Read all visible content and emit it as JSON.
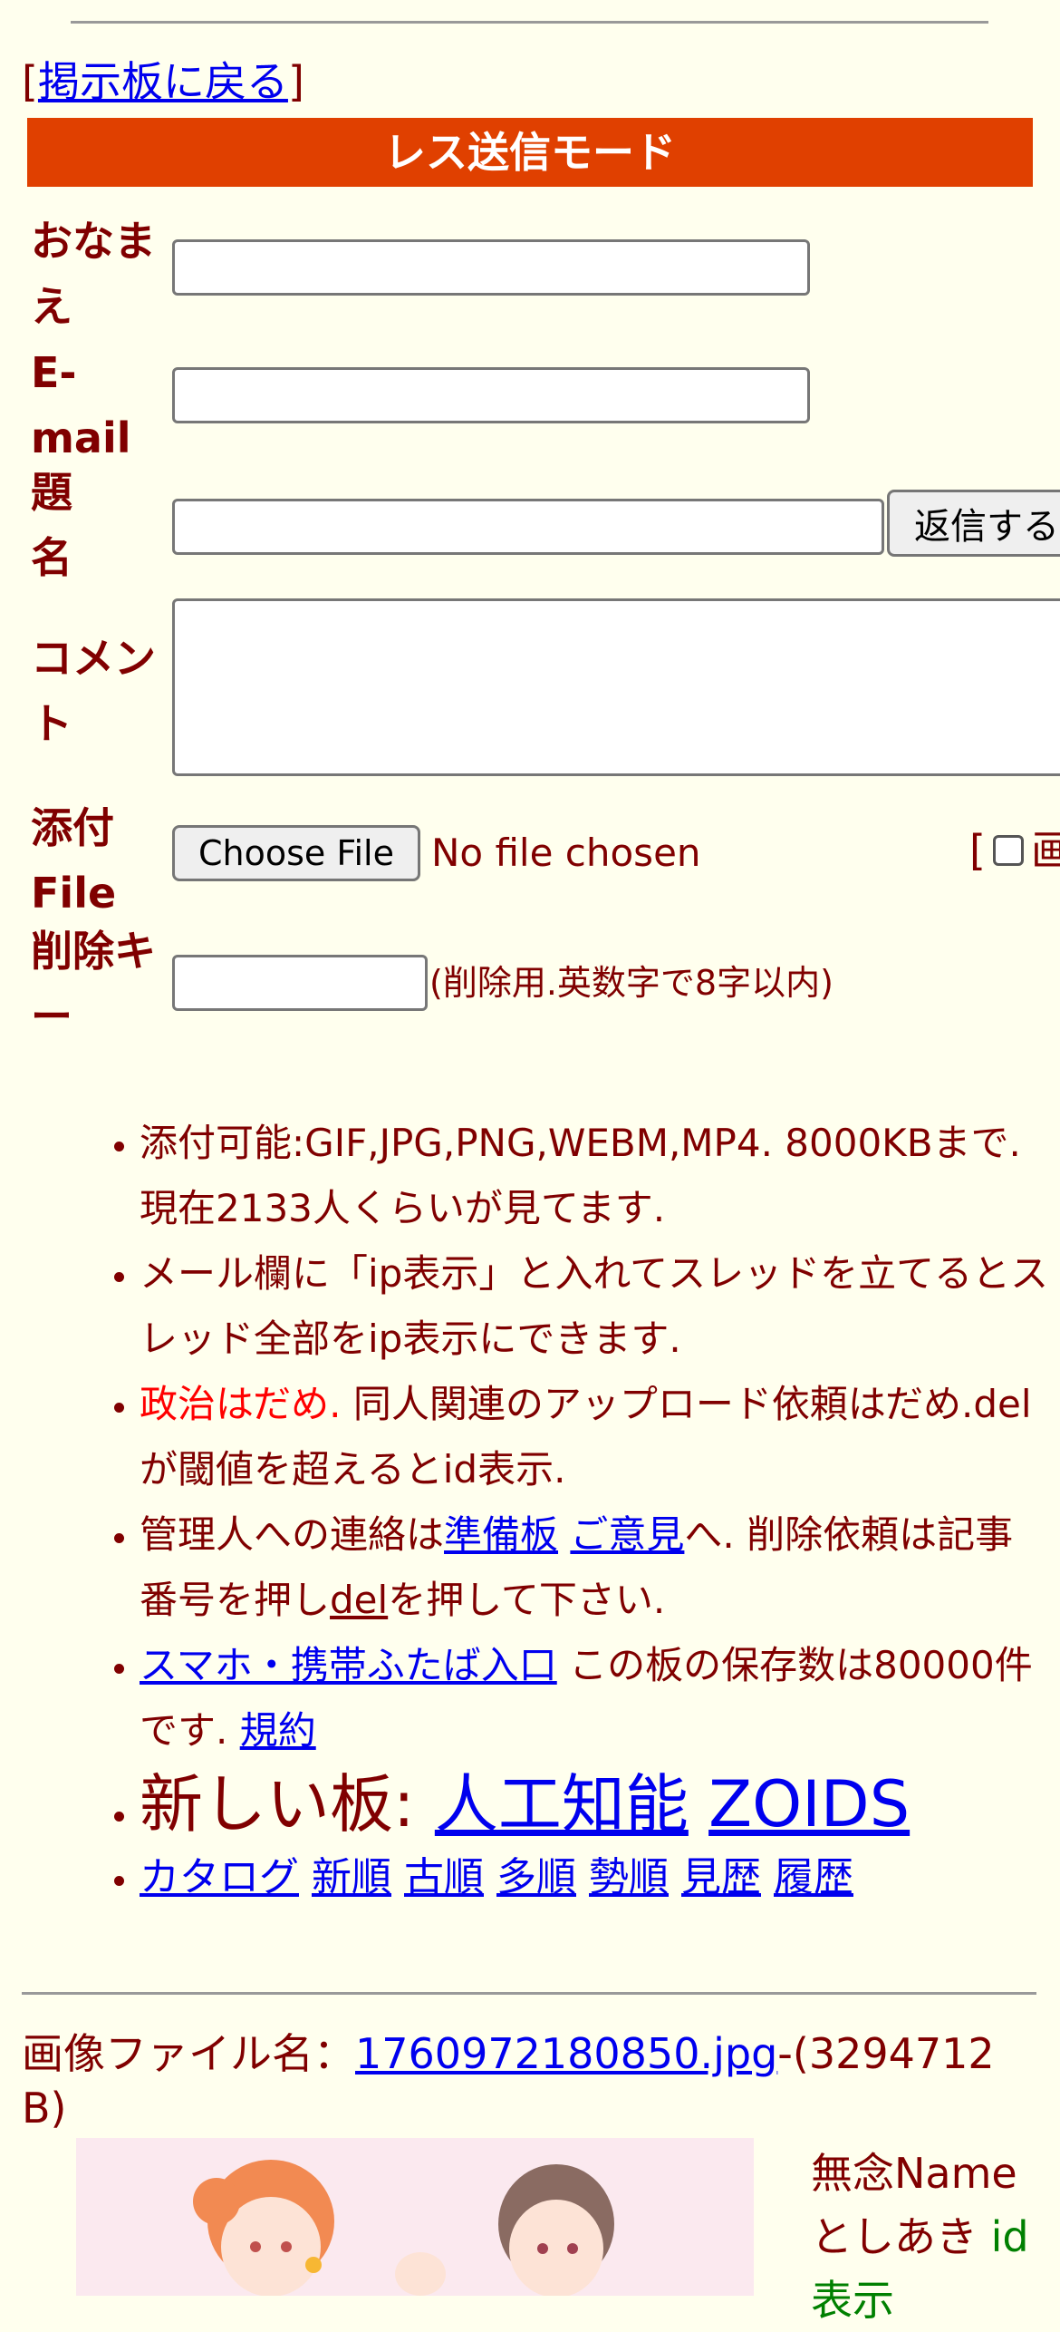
{
  "nav": {
    "bracket_open": "[",
    "back_link": "掲示板に戻る",
    "bracket_close": "]"
  },
  "mode_bar": "レス送信モード",
  "form": {
    "name_label_1": "おなま",
    "name_label_2": "え",
    "email_label_1": "E-",
    "email_label_2": "mail",
    "subject_label_1": "題",
    "subject_label_2": "名",
    "submit_button": "返信する",
    "comment_label_1": "コメン",
    "comment_label_2": "ト",
    "file_label_1": "添付",
    "file_label_2": "File",
    "choose_file_button": "Choose File",
    "no_file_text": "No file chosen",
    "checkbox_bracket": "[",
    "checkbox_trailing": "画",
    "delkey_label_1": "削除キ",
    "delkey_label_2": "ー",
    "delkey_note": "(削除用.英数字で8字以内)"
  },
  "rules": {
    "r1": "添付可能:GIF,JPG,PNG,WEBM,MP4. 8000KBまで. 現在2133人くらいが見てます.",
    "r2": "メール欄に「ip表示」と入れてスレッドを立てるとスレッド全部をip表示にできます.",
    "r3_red": "政治はだめ.",
    "r3_rest": " 同人関連のアップロード依頼はだめ.delが閾値を超えるとid表示.",
    "r4_a": "管理人への連絡は",
    "r4_link1": "準備板",
    "r4_link2": "ご意見",
    "r4_b": "へ. 削除依頼は記事番号を押し",
    "r4_link3": "del",
    "r4_c": "を押して下さい.",
    "r5_link": "スマホ・携帯ふたば入口",
    "r5_text": " この板の保存数は80000件です. ",
    "r5_link2": "規約",
    "r6_text": "新しい板: ",
    "r6_link1": "人工知能",
    "r6_link2": "ZOIDS",
    "r7_links": [
      "カタログ",
      "新順",
      "古順",
      "多順",
      "勢順",
      "見歴",
      "履歴"
    ]
  },
  "post": {
    "file_label": "画像ファイル名：",
    "file_link": "1760972180850.jpg",
    "file_size": "-(3294712 B)",
    "name": "無念Name",
    "user": "としあき",
    "id_text": "id",
    "id_text2": "表示"
  },
  "colors": {
    "background": "#ffffee",
    "text": "#800000",
    "mode_bar": "#e04000",
    "link": "#0000ee",
    "red": "#ff0000",
    "green": "#008000"
  }
}
